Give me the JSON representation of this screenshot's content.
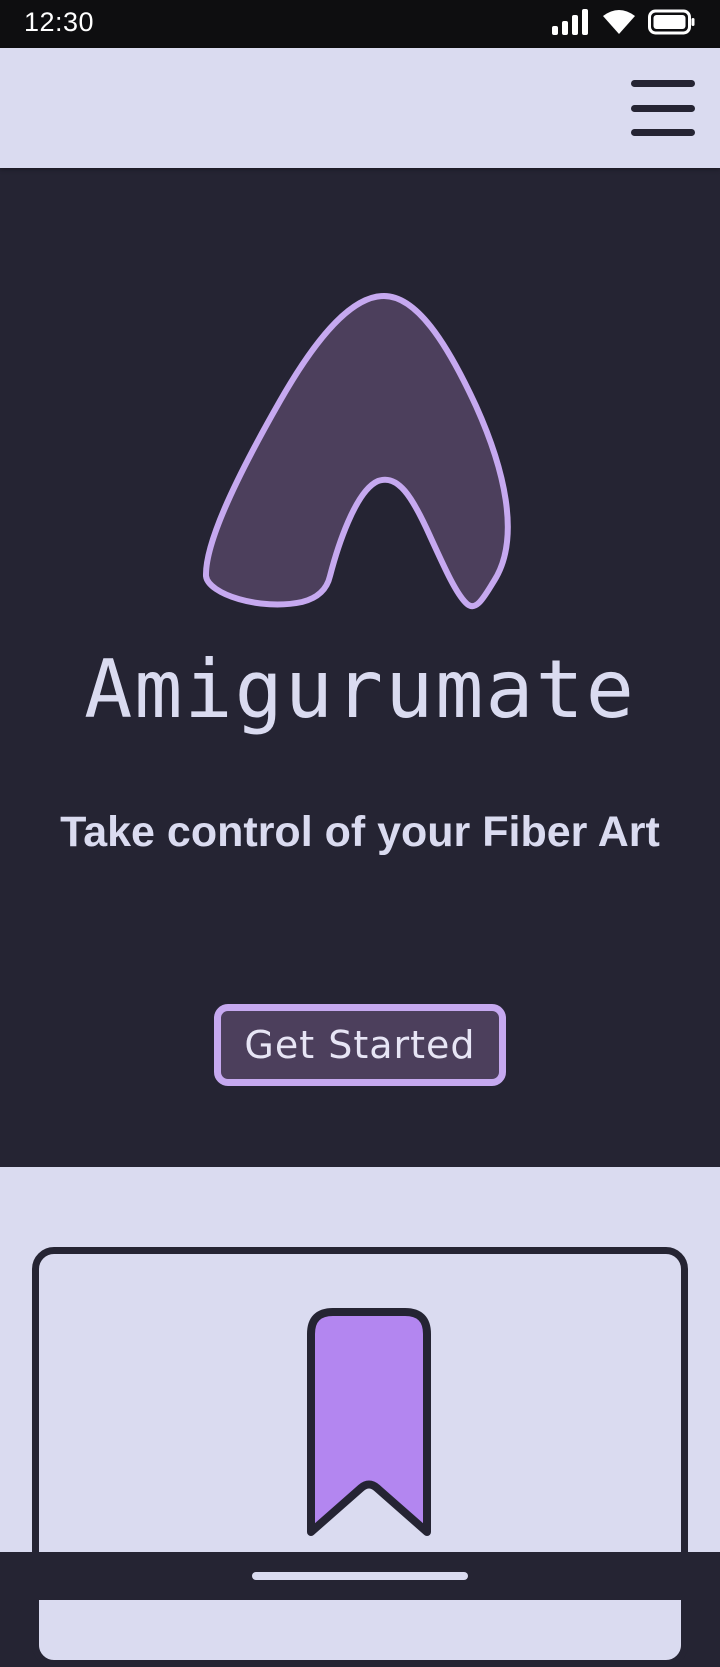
{
  "status_bar": {
    "time": "12:30",
    "icons": [
      "signal-icon",
      "wifi-icon",
      "battery-icon"
    ]
  },
  "header": {
    "menu_icon": "hamburger-menu-icon"
  },
  "hero": {
    "logo_icon": "amigurumate-logo-icon",
    "brand_name": "Amigurumate",
    "tagline": "Take control of your Fiber Art",
    "cta_label": "Get Started"
  },
  "features": {
    "card_icon": "bookmark-icon"
  },
  "colors": {
    "dark_background": "#252433",
    "light_background": "#dadbf0",
    "accent_outline": "#c6a9f0",
    "accent_fill": "#4c3f5c",
    "bookmark_fill": "#b386f0"
  }
}
